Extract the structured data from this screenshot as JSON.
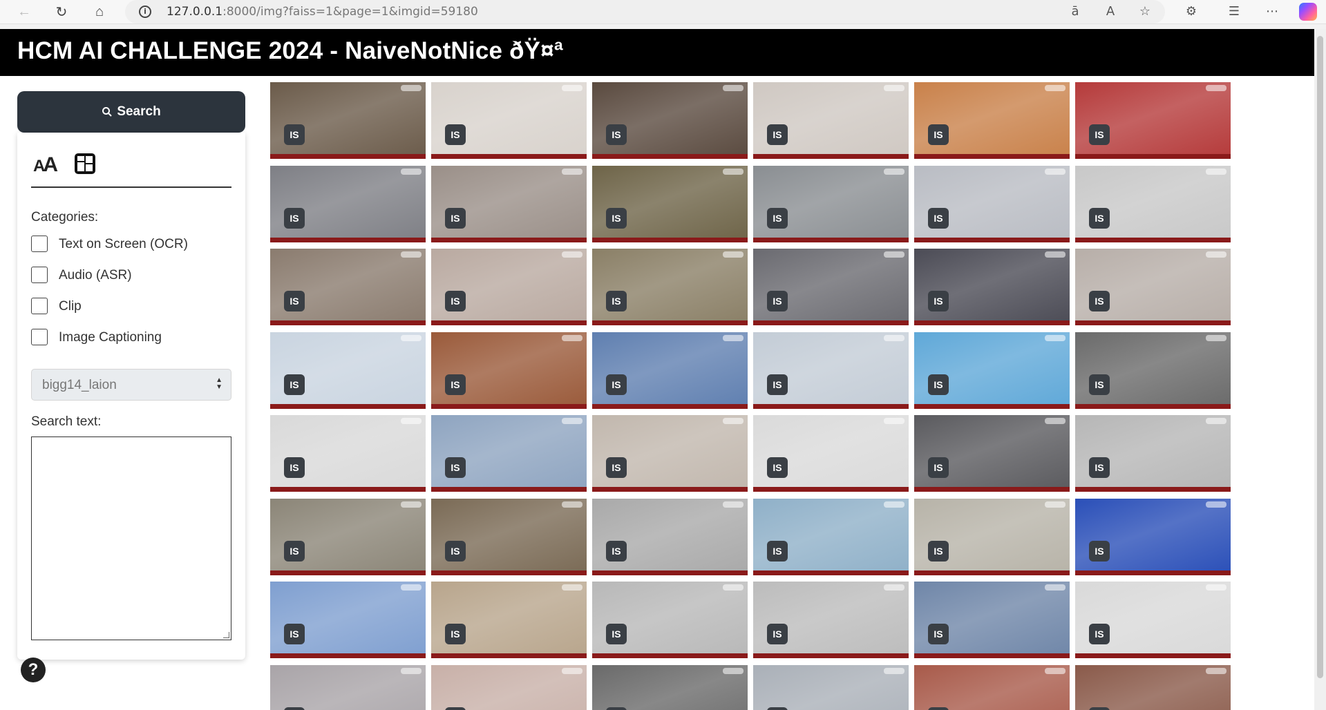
{
  "browser": {
    "url_host": "127.0.0.1",
    "url_rest": ":8000/img?faiss=1&page=1&imgid=59180",
    "icons": [
      "back-icon",
      "refresh-icon",
      "home-icon",
      "info-icon",
      "translate-icon",
      "read-aloud-icon",
      "favorite-icon",
      "extensions-icon",
      "favorites-icon",
      "more-icon",
      "copilot-icon"
    ]
  },
  "header": {
    "title": "HCM AI CHALLENGE 2024 - NaiveNotNice ðŸ¤ª"
  },
  "sidebar": {
    "search_button": "Search",
    "categories_label": "Categories:",
    "categories": [
      "Text on Screen (OCR)",
      "Audio (ASR)",
      "Clip",
      "Image Captioning"
    ],
    "model_select": "bigg14_laion",
    "search_text_label": "Search text:",
    "search_text_value": "",
    "help": "?"
  },
  "grid": {
    "tag": "IS",
    "columns": 6,
    "colors": [
      [
        "#6b5b4a",
        "#d8d2cc",
        "#5a4a3f",
        "#cfc8c2",
        "#c9814a",
        "#b53a3a"
      ],
      [
        "#7e7f85",
        "#9a8f88",
        "#6e6448",
        "#8a8e92",
        "#b9bcc3",
        "#c8c8c8"
      ],
      [
        "#8a7b6e",
        "#b9a9a0",
        "#8a7f66",
        "#6a6a70",
        "#4b4b55",
        "#b7aea8"
      ],
      [
        "#c9d4e0",
        "#9a5a3a",
        "#5f7fb0",
        "#c3ccd6",
        "#5fa8d8",
        "#6a6a6a"
      ],
      [
        "#d9d9d9",
        "#8ea4c0",
        "#c1b7ad",
        "#dadada",
        "#5a5a5e",
        "#b6b6b6"
      ],
      [
        "#8b8577",
        "#7a6a55",
        "#a9a9a9",
        "#8fb0c8",
        "#b7b3a8",
        "#2a4fb8"
      ],
      [
        "#7f9fd0",
        "#b8a58c",
        "#b8b8b8",
        "#bcbcbc",
        "#6f86a8",
        "#d9d9d9"
      ],
      [
        "#a9a4a8",
        "#c8b0a8",
        "#6a6a6a",
        "#aab0b8",
        "#a85a4a",
        "#8a5a4a"
      ]
    ]
  }
}
